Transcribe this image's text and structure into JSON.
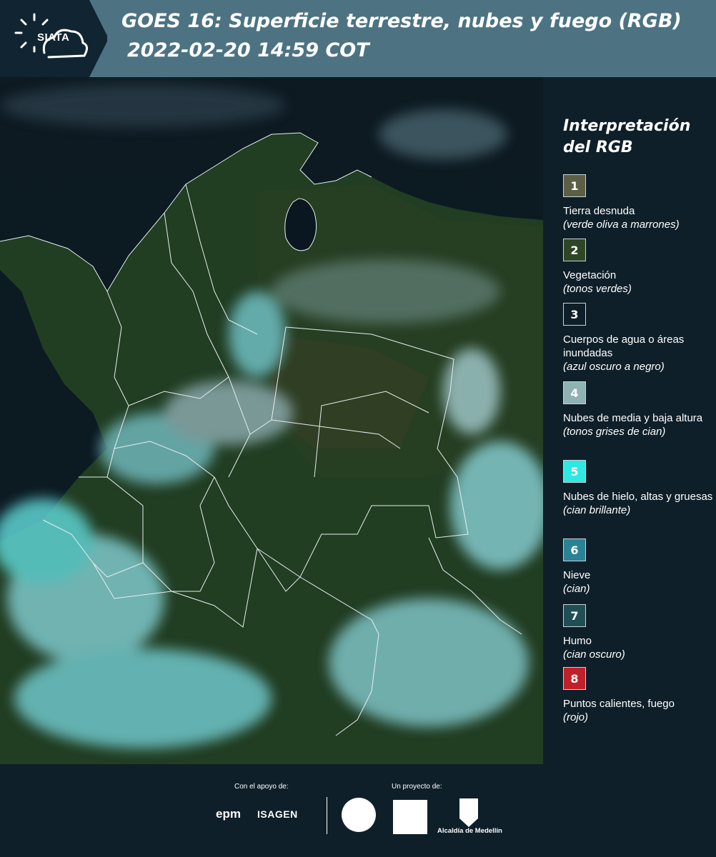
{
  "header": {
    "logo_text": "SIATA",
    "title_line1": "GOES 16: Superficie terrestre, nubes y fuego (RGB)",
    "title_line2": "2022-02-20 14:59 COT"
  },
  "legend": {
    "title": "Interpretación del RGB",
    "items": [
      {
        "num": "1",
        "label": "Tierra desnuda",
        "desc": "(verde oliva a marrones)",
        "color": "#5c5e46"
      },
      {
        "num": "2",
        "label": "Vegetación",
        "desc": "(tonos verdes)",
        "color": "#2f4626"
      },
      {
        "num": "3",
        "label": "Cuerpos de agua o áreas inundadas",
        "desc": "(azul oscuro a negro)",
        "color": "#0f1f29"
      },
      {
        "num": "4",
        "label": "Nubes de media y baja altura",
        "desc": "(tonos grises de cian)",
        "color": "#8fb2b3"
      },
      {
        "num": "5",
        "label": "Nubes de hielo, altas y gruesas",
        "desc": "(cian brillante)",
        "color": "#2ee8e2"
      },
      {
        "num": "6",
        "label": "Nieve",
        "desc": "(cian)",
        "color": "#2a8296"
      },
      {
        "num": "7",
        "label": "Humo",
        "desc": "(cian oscuro)",
        "color": "#1f4f54"
      },
      {
        "num": "8",
        "label": "Puntos calientes, fuego",
        "desc": "(rojo)",
        "color": "#c0202a"
      }
    ]
  },
  "footer": {
    "support_label": "Con el apoyo de:",
    "project_label": "Un proyecto de:",
    "epm": "epm",
    "isagen": "ISAGEN",
    "alcaldia": "Alcaldía de Medellín"
  }
}
